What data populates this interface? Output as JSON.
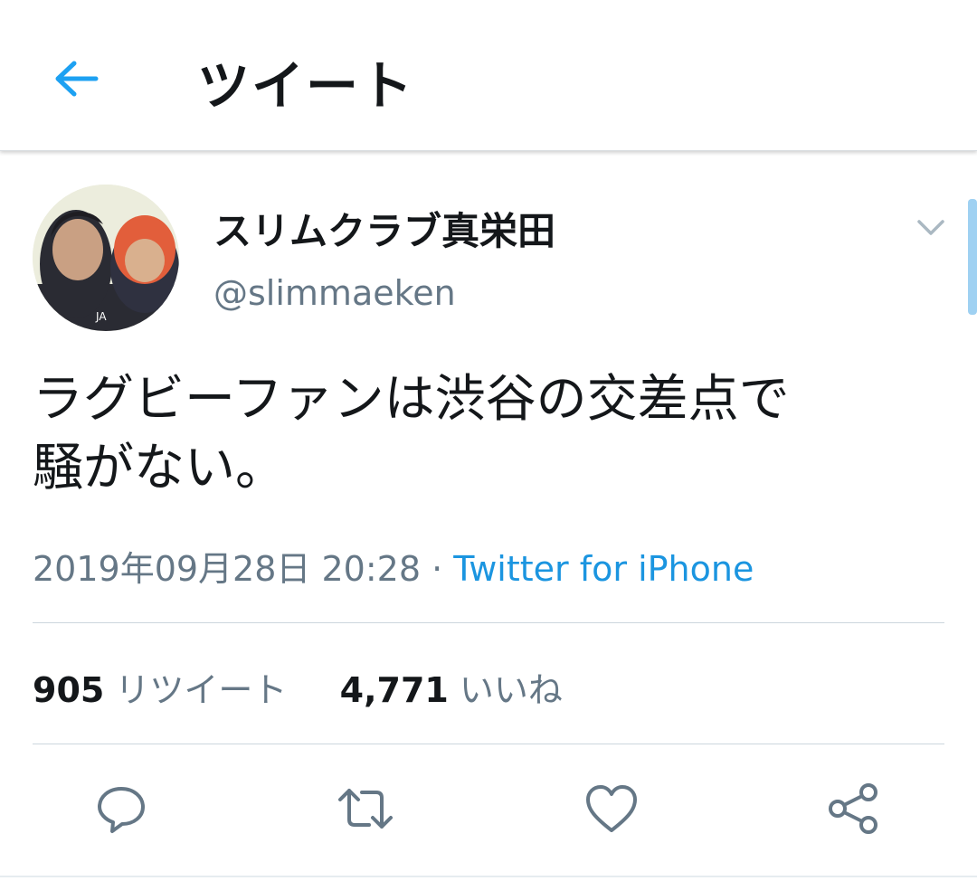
{
  "header": {
    "title": "ツイート",
    "back_icon": "arrow-left-icon",
    "accent": "#1da1f2"
  },
  "tweet": {
    "display_name": "スリムクラブ真栄田",
    "handle": "@slimmaeken",
    "text_line1": "ラグビーファンは渋谷の交差点で",
    "text_line2": "騒がない。",
    "timestamp": "2019年09月28日 20:28",
    "separator": "·",
    "source": "Twitter for iPhone",
    "source_color": "#1b95e0"
  },
  "stats": {
    "retweets_count": "905",
    "retweets_label": "リツイート",
    "likes_count": "4,771",
    "likes_label": "いいね"
  },
  "actions": [
    "reply-icon",
    "retweet-icon",
    "like-icon",
    "share-icon"
  ]
}
